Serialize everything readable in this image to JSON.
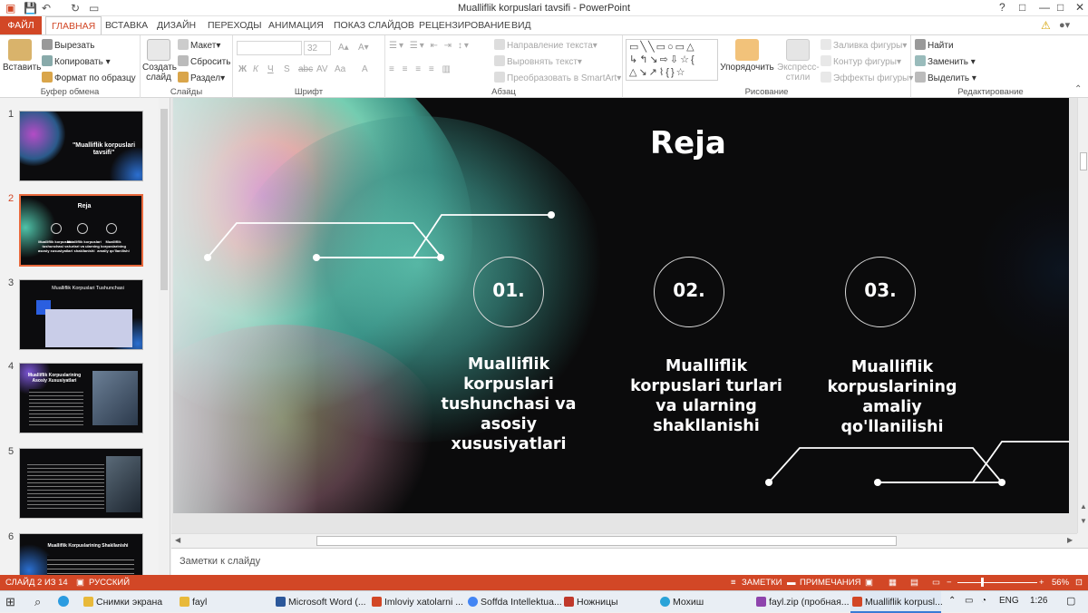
{
  "window": {
    "title": "Mualliflik korpuslari tavsifi - PowerPoint",
    "controls": [
      "?",
      "□",
      "—",
      "□",
      "✕"
    ]
  },
  "account": {
    "warning_icon": "⚠"
  },
  "tabs": [
    {
      "label": "ФАЙЛ"
    },
    {
      "label": "ГЛАВНАЯ"
    },
    {
      "label": "ВСТАВКА"
    },
    {
      "label": "ДИЗАЙН"
    },
    {
      "label": "ПЕРЕХОДЫ"
    },
    {
      "label": "АНИМАЦИЯ"
    },
    {
      "label": "ПОКАЗ СЛАЙДОВ"
    },
    {
      "label": "РЕЦЕНЗИРОВАНИЕ"
    },
    {
      "label": "ВИД"
    }
  ],
  "ribbon": {
    "clipboard": {
      "label": "Буфер обмена",
      "paste": "Вставить",
      "cut": "Вырезать",
      "copy": "Копировать",
      "format_painter": "Формат по образцу"
    },
    "slides": {
      "label": "Слайды",
      "new_slide": "Создать слайд",
      "layout": "Макет",
      "reset": "Сбросить",
      "section": "Раздел"
    },
    "font": {
      "label": "Шрифт",
      "size": "32",
      "bold": "Ж",
      "italic": "К",
      "underline": "Ч",
      "shadow": "S",
      "strike": "abc",
      "spacing": "AV",
      "case": "Aa",
      "color": "A"
    },
    "paragraph": {
      "label": "Абзац",
      "text_direction": "Направление текста",
      "align_text": "Выровнять текст",
      "smartart": "Преобразовать в SmartArt"
    },
    "drawing": {
      "label": "Рисование",
      "arrange": "Упорядочить",
      "quick_styles": "Экспресс-стили",
      "shape_fill": "Заливка фигуры",
      "shape_outline": "Контур фигуры",
      "shape_effects": "Эффекты фигуры"
    },
    "editing": {
      "label": "Редактирование",
      "find": "Найти",
      "replace": "Заменить",
      "select": "Выделить"
    }
  },
  "thumbnails": [
    {
      "num": "1",
      "title": "\"Mualliflik korpuslari tavsifi\""
    },
    {
      "num": "2",
      "title": "Reja",
      "items": [
        "01.",
        "02.",
        "03."
      ]
    },
    {
      "num": "3",
      "title": "Mualliflik Korpuslari Tushunchasi"
    },
    {
      "num": "4",
      "title": "Mualliflik Korpuslarining Asosiy Xususiyatlari"
    },
    {
      "num": "5",
      "title": ""
    },
    {
      "num": "6",
      "title": "Mualliflik Korpuslarining Shakllanishi"
    }
  ],
  "slide": {
    "title": "Reja",
    "items": [
      {
        "num": "01.",
        "text": "Mualliflik korpuslari tushunchasi va asosiy xususiyatlari"
      },
      {
        "num": "02.",
        "text": "Mualliflik korpuslari turlari va ularning shakllanishi"
      },
      {
        "num": "03.",
        "text": "Mualliflik korpuslarining amaliy qo'llanilishi"
      }
    ]
  },
  "notes": {
    "placeholder": "Заметки к слайду"
  },
  "statusbar": {
    "slide": "СЛАЙД 2 ИЗ 14",
    "language": "РУССКИЙ",
    "notes": "ЗАМЕТКИ",
    "comments": "ПРИМЕЧАНИЯ",
    "zoom": "56%"
  },
  "taskbar": {
    "apps": [
      {
        "label": "Снимки экрана",
        "color": "#e8b93a"
      },
      {
        "label": "fayl",
        "color": "#e8b93a"
      },
      {
        "label": "Microsoft Word (...",
        "color": "#2b579a"
      },
      {
        "label": "Imloviy xatolarni ...",
        "color": "#d24726"
      },
      {
        "label": "Soffda Intellektua...",
        "color": "#4285f4"
      },
      {
        "label": "Ножницы",
        "color": "#c0392b"
      },
      {
        "label": "Мохиш",
        "color": "#2aa3d8"
      },
      {
        "label": "fayl.zip (пробная...",
        "color": "#8e44ad"
      },
      {
        "label": "Mualliflik korpusl...",
        "color": "#d24726"
      }
    ],
    "lang": "ENG",
    "time": "1:26"
  }
}
